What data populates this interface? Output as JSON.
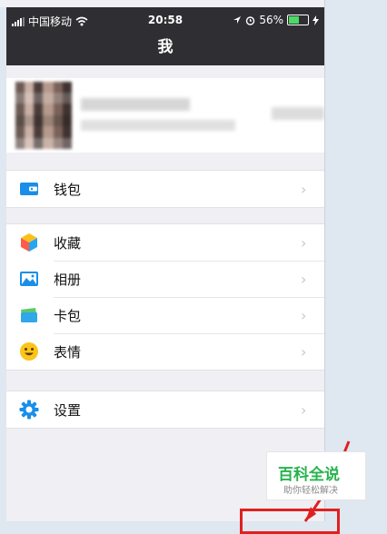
{
  "status_bar": {
    "carrier": "中国移动",
    "wifi_icon": "wifi-icon",
    "time": "20:58",
    "battery_percent": "56%",
    "battery_level": 0.56,
    "battery_color": "#4cd964"
  },
  "nav": {
    "title": "我"
  },
  "menu": {
    "wallet": {
      "label": "钱包",
      "icon": "wallet-icon"
    },
    "favorites": {
      "label": "收藏",
      "icon": "favorites-cube-icon"
    },
    "album": {
      "label": "相册",
      "icon": "album-photo-icon"
    },
    "cards": {
      "label": "卡包",
      "icon": "card-package-icon"
    },
    "stickers": {
      "label": "表情",
      "icon": "smiley-face-icon"
    },
    "settings": {
      "label": "设置",
      "icon": "gear-icon"
    }
  },
  "watermark": {
    "title": "百科全说",
    "subtitle": "助你轻松解决"
  },
  "colors": {
    "nav_bg": "#2f2f33",
    "page_bg": "#efeff4",
    "accent_green": "#27b34d",
    "annotation_red": "#e02020"
  }
}
